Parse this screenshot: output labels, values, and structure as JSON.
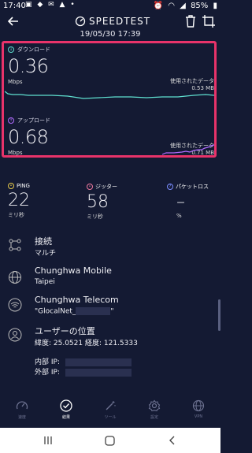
{
  "status_bar": {
    "time": "17:40",
    "left_icons": "▣ ◆ ✉ ▲ •",
    "battery": "85%",
    "icons": [
      "alarm-icon",
      "wifi-icon",
      "signal-icon",
      "battery-icon"
    ]
  },
  "header": {
    "title": "SPEEDTEST",
    "date": "19/05/30 17:39"
  },
  "download": {
    "label": "ダウンロード",
    "value": "0.36",
    "unit": "Mbps",
    "data_label": "使用されたデータ",
    "data_value": "0.53 MB",
    "color": "#5fe0d0"
  },
  "upload": {
    "label": "アップロード",
    "value": "0.68",
    "unit": "Mbps",
    "data_label": "使用されたデータ",
    "data_value": "0.71 MB",
    "color": "#b06cff"
  },
  "stats": {
    "ping": {
      "label": "PING",
      "value": "22",
      "unit": "ミリ秒"
    },
    "jitter": {
      "label": "ジッター",
      "value": "58",
      "unit": "ミリ秒"
    },
    "packet_loss": {
      "label": "パケットロス",
      "value": "–",
      "unit": "%"
    }
  },
  "info": {
    "connection": {
      "title": "接続",
      "sub": "マルチ"
    },
    "server": {
      "title": "Chunghwa Mobile",
      "sub": "Taipei"
    },
    "provider": {
      "title": "Chunghwa Telecom",
      "sub": "\"GlocalNet_",
      "sub_end": "\""
    },
    "location": {
      "title": "ユーザーの位置",
      "sub": "緯度: 25.0521 経度: 121.5333"
    },
    "internal_ip_label": "内部 IP:",
    "external_ip_label": "外部 IP:"
  },
  "nav": {
    "items": [
      {
        "label": "速度",
        "icon": "speedometer-icon"
      },
      {
        "label": "結果",
        "icon": "check-circle-icon"
      },
      {
        "label": "ツール",
        "icon": "wand-icon"
      },
      {
        "label": "設定",
        "icon": "gear-icon"
      },
      {
        "label": "VPN",
        "icon": "vpn-globe-icon"
      }
    ]
  },
  "system_nav": [
    "recent-apps-icon",
    "home-icon",
    "back-icon"
  ]
}
